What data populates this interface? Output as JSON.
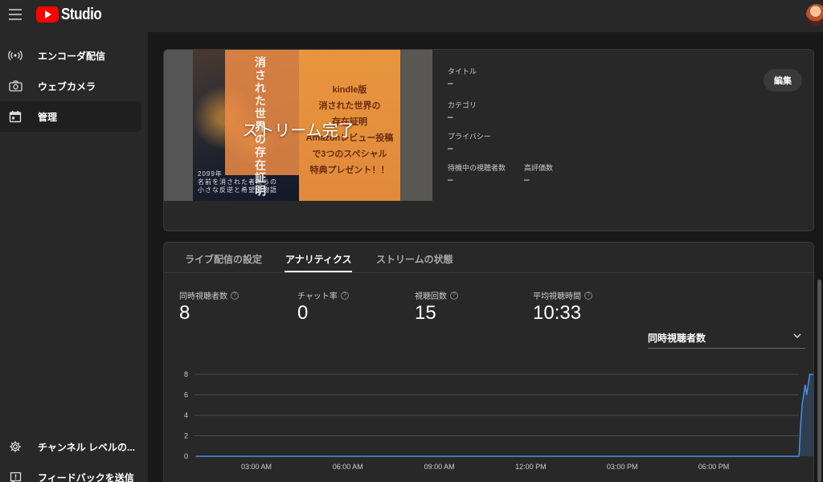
{
  "app": {
    "logo_text": "Studio",
    "colors": {
      "brand": "#ff0000",
      "background": "#282828",
      "main_bg": "#181818",
      "line": "#4a90e2"
    }
  },
  "sidebar": {
    "items": [
      {
        "label": "エンコーダ配信",
        "icon": "broadcast-icon"
      },
      {
        "label": "ウェブカメラ",
        "icon": "camera-icon"
      },
      {
        "label": "管理",
        "icon": "calendar-icon",
        "active": true
      }
    ],
    "bottom": [
      {
        "label": "チャンネル レベルの...",
        "icon": "gear-icon"
      },
      {
        "label": "フィードバックを送信",
        "icon": "feedback-icon"
      }
    ]
  },
  "stream": {
    "overlay": "ストリーム完了",
    "thumbnail": {
      "headline_lines": [
        "kindle版",
        "消された世界の",
        "存在証明",
        "Amazonレビュー投稿",
        "で3つのスペシャル",
        "特典プレゼント！！"
      ],
      "vertical": "消された世界の存在証明",
      "bottom_lines": [
        "2099年",
        "名前を消された者たちの",
        "小さな反逆と希望の物語"
      ]
    },
    "meta": {
      "title_label": "タイトル",
      "title_value": "–",
      "category_label": "カテゴリ",
      "category_value": "–",
      "privacy_label": "プライバシー",
      "privacy_value": "–",
      "waiting_label": "待機中の視聴者数",
      "waiting_value": "–",
      "likes_label": "高評価数",
      "likes_value": "–"
    },
    "edit_label": "編集"
  },
  "tabs": [
    {
      "label": "ライブ配信の設定"
    },
    {
      "label": "アナリティクス",
      "active": true
    },
    {
      "label": "ストリームの状態"
    }
  ],
  "stats": [
    {
      "label": "同時視聴者数",
      "value": "8"
    },
    {
      "label": "チャット率",
      "value": "0"
    },
    {
      "label": "視聴回数",
      "value": "15"
    },
    {
      "label": "平均視聴時間",
      "value": "10:33"
    }
  ],
  "dropdown": {
    "selected": "同時視聴者数"
  },
  "chart_data": {
    "type": "area",
    "x_ticks": [
      "03:00 AM",
      "06:00 AM",
      "09:00 AM",
      "12:00 PM",
      "03:00 PM",
      "06:00 PM"
    ],
    "y_ticks": [
      0,
      2,
      4,
      6,
      8
    ],
    "ylim": [
      0,
      8
    ],
    "series": [
      {
        "x_hours": [
          0,
          20.8,
          20.85,
          20.9,
          21.0,
          21.05,
          21.15,
          21.2,
          21.7
        ],
        "values": [
          0,
          0,
          3,
          5,
          7,
          6,
          8,
          8,
          8
        ]
      }
    ],
    "grid": true
  }
}
